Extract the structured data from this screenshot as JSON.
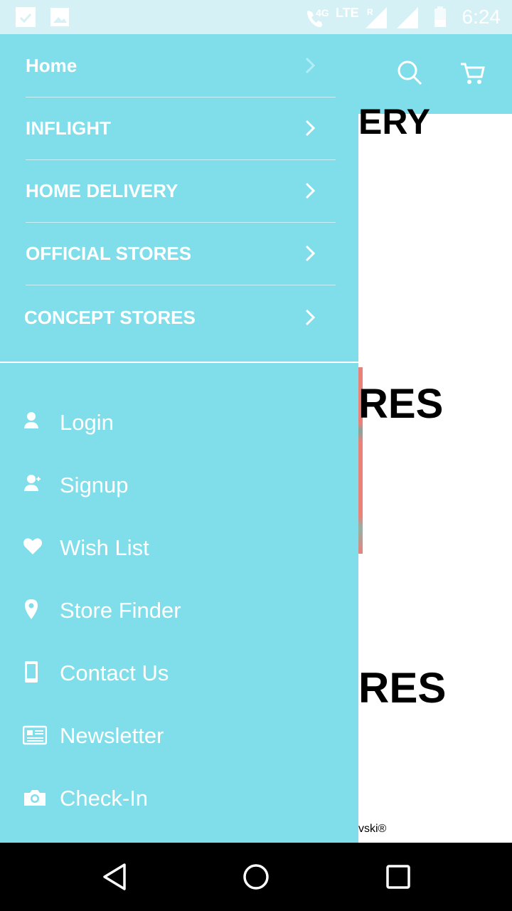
{
  "status_bar": {
    "network_4g": "4G",
    "network_lte": "LTE",
    "roaming": "R",
    "time": "6:24"
  },
  "background": {
    "heading_1": "ERY",
    "heading_2": "RES",
    "heading_3": "RES",
    "footer_text": "vski®"
  },
  "drawer": {
    "categories": [
      {
        "label": "Home",
        "icon": "chevron-right-icon"
      },
      {
        "label": "INFLIGHT",
        "icon": "chevron-right-icon"
      },
      {
        "label": "HOME DELIVERY",
        "icon": "chevron-right-icon"
      },
      {
        "label": "OFFICIAL STORES",
        "icon": "chevron-right-icon"
      },
      {
        "label": "CONCEPT STORES",
        "icon": "chevron-right-icon"
      }
    ],
    "account_items": [
      {
        "label": "Login",
        "icon": "user-icon"
      },
      {
        "label": "Signup",
        "icon": "user-add-icon"
      },
      {
        "label": "Wish List",
        "icon": "heart-icon"
      },
      {
        "label": "Store Finder",
        "icon": "map-pin-icon"
      },
      {
        "label": "Contact Us",
        "icon": "phone-icon"
      },
      {
        "label": "Newsletter",
        "icon": "newspaper-icon"
      },
      {
        "label": "Check-In",
        "icon": "camera-icon"
      }
    ]
  },
  "colors": {
    "drawer_bg": "#80deea",
    "status_bar_bg": "#d6f1f5",
    "text": "#ffffff",
    "nav_bar_bg": "#000000"
  }
}
